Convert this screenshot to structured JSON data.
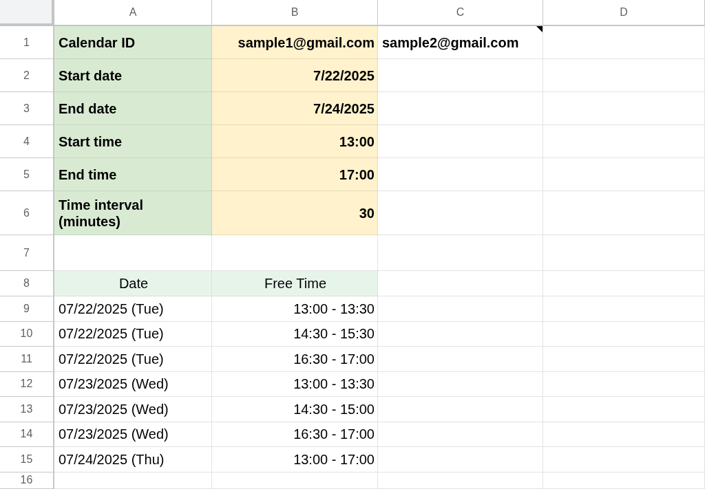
{
  "columns": [
    "A",
    "B",
    "C",
    "D"
  ],
  "rows": [
    {
      "number": "1",
      "cells": [
        {
          "kind": "label",
          "text": "Calendar ID"
        },
        {
          "kind": "input",
          "text": "sample1@gmail.com"
        },
        {
          "kind": "bold",
          "text": "sample2@gmail.com",
          "comment": true
        },
        {
          "kind": "plain"
        }
      ]
    },
    {
      "number": "2",
      "cells": [
        {
          "kind": "label",
          "text": "Start date"
        },
        {
          "kind": "input",
          "text": "7/22/2025"
        },
        {
          "kind": "plain"
        },
        {
          "kind": "plain"
        }
      ]
    },
    {
      "number": "3",
      "cells": [
        {
          "kind": "label",
          "text": "End date"
        },
        {
          "kind": "input",
          "text": "7/24/2025"
        },
        {
          "kind": "plain"
        },
        {
          "kind": "plain"
        }
      ]
    },
    {
      "number": "4",
      "cells": [
        {
          "kind": "label",
          "text": "Start time"
        },
        {
          "kind": "input",
          "text": "13:00"
        },
        {
          "kind": "plain"
        },
        {
          "kind": "plain"
        }
      ]
    },
    {
      "number": "5",
      "cells": [
        {
          "kind": "label",
          "text": "End time"
        },
        {
          "kind": "input",
          "text": "17:00"
        },
        {
          "kind": "plain"
        },
        {
          "kind": "plain"
        }
      ]
    },
    {
      "number": "6",
      "cells": [
        {
          "kind": "label",
          "text": "Time interval (minutes)"
        },
        {
          "kind": "input",
          "text": "30"
        },
        {
          "kind": "plain"
        },
        {
          "kind": "plain"
        }
      ]
    },
    {
      "number": "7",
      "cells": [
        {
          "kind": "plain"
        },
        {
          "kind": "plain"
        },
        {
          "kind": "plain"
        },
        {
          "kind": "plain"
        }
      ]
    },
    {
      "number": "8",
      "cells": [
        {
          "kind": "header",
          "text": "Date"
        },
        {
          "kind": "header",
          "text": "Free Time"
        },
        {
          "kind": "plain"
        },
        {
          "kind": "plain"
        }
      ]
    },
    {
      "number": "9",
      "cells": [
        {
          "kind": "plain",
          "text": "07/22/2025 (Tue)"
        },
        {
          "kind": "number",
          "text": "13:00 - 13:30"
        },
        {
          "kind": "plain"
        },
        {
          "kind": "plain"
        }
      ]
    },
    {
      "number": "10",
      "cells": [
        {
          "kind": "plain",
          "text": "07/22/2025 (Tue)"
        },
        {
          "kind": "number",
          "text": "14:30 - 15:30"
        },
        {
          "kind": "plain"
        },
        {
          "kind": "plain"
        }
      ]
    },
    {
      "number": "11",
      "cells": [
        {
          "kind": "plain",
          "text": "07/22/2025 (Tue)"
        },
        {
          "kind": "number",
          "text": "16:30 - 17:00"
        },
        {
          "kind": "plain"
        },
        {
          "kind": "plain"
        }
      ]
    },
    {
      "number": "12",
      "cells": [
        {
          "kind": "plain",
          "text": "07/23/2025 (Wed)"
        },
        {
          "kind": "number",
          "text": "13:00 - 13:30"
        },
        {
          "kind": "plain"
        },
        {
          "kind": "plain"
        }
      ]
    },
    {
      "number": "13",
      "cells": [
        {
          "kind": "plain",
          "text": "07/23/2025 (Wed)"
        },
        {
          "kind": "number",
          "text": "14:30 - 15:00"
        },
        {
          "kind": "plain"
        },
        {
          "kind": "plain"
        }
      ]
    },
    {
      "number": "14",
      "cells": [
        {
          "kind": "plain",
          "text": "07/23/2025 (Wed)"
        },
        {
          "kind": "number",
          "text": "16:30 - 17:00"
        },
        {
          "kind": "plain"
        },
        {
          "kind": "plain"
        }
      ]
    },
    {
      "number": "15",
      "cells": [
        {
          "kind": "plain",
          "text": "07/24/2025 (Thu)"
        },
        {
          "kind": "number",
          "text": "13:00 - 17:00"
        },
        {
          "kind": "plain"
        },
        {
          "kind": "plain"
        }
      ]
    },
    {
      "number": "16",
      "cells": [
        {
          "kind": "plain"
        },
        {
          "kind": "plain"
        },
        {
          "kind": "plain"
        },
        {
          "kind": "plain"
        }
      ]
    }
  ]
}
